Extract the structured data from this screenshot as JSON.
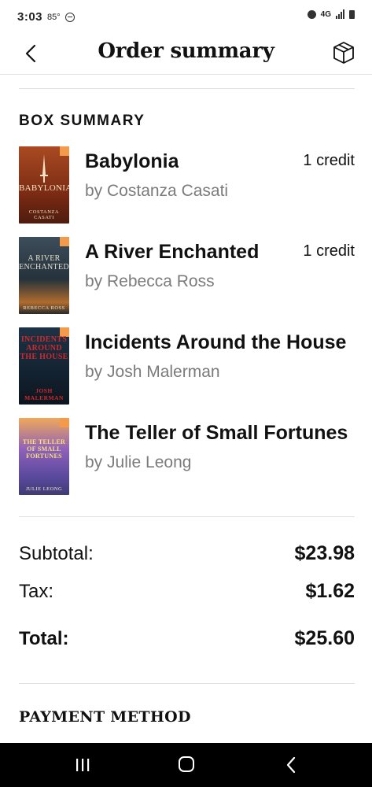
{
  "status_bar": {
    "time": "3:03",
    "temperature": "85°",
    "network": "4G",
    "icons": [
      "do-not-disturb-icon",
      "alarm-icon",
      "signal-icon",
      "battery-icon"
    ]
  },
  "header": {
    "title": "Order summary",
    "back_icon": "chevron-left-icon",
    "box_icon": "box-icon"
  },
  "box_summary": {
    "heading": "BOX SUMMARY",
    "items": [
      {
        "title": "Babylonia",
        "author": "by Costanza Casati",
        "credit": "1 credit",
        "cover": {
          "title": "BABYLONIA",
          "author": "COSTANZA CASATI",
          "bg": "#9c3d1f",
          "fg": "#f4e3c3"
        }
      },
      {
        "title": "A River Enchanted",
        "author": "by Rebecca Ross",
        "credit": "1 credit",
        "cover": {
          "title": "A RIVER ENCHANTED",
          "author": "REBECCA ROSS",
          "bg": "#2e3b46",
          "fg": "#e7e1cf"
        }
      },
      {
        "title": "Incidents Around the House",
        "author": "by Josh Malerman",
        "credit": "",
        "cover": {
          "title": "INCIDENTS AROUND THE HOUSE",
          "author": "JOSH MALERMAN",
          "bg": "#152432",
          "fg": "#c8272b"
        }
      },
      {
        "title": "The Teller of Small Fortunes",
        "author": "by Julie Leong",
        "credit": "",
        "cover": {
          "title": "THE TELLER OF SMALL FORTUNES",
          "author": "JULIE LEONG",
          "bg": "#7a5aa8",
          "fg": "#ffe27a"
        }
      }
    ]
  },
  "totals": {
    "subtotal_label": "Subtotal:",
    "subtotal_value": "$23.98",
    "tax_label": "Tax:",
    "tax_value": "$1.62",
    "total_label": "Total:",
    "total_value": "$25.60"
  },
  "payment": {
    "heading": "PAYMENT METHOD"
  },
  "nav_bar": {
    "recent_icon": "recent-apps-icon",
    "home_icon": "home-icon",
    "back_icon": "back-icon"
  },
  "colors": {
    "accent_badge": "#f39b4a",
    "muted_text": "#7b7b7b",
    "divider": "#e2e2e2"
  }
}
